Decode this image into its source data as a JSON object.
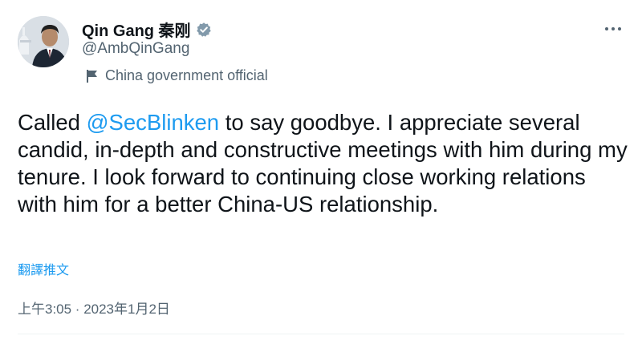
{
  "author": {
    "display_name": "Qin Gang 秦刚",
    "handle": "@AmbQinGang",
    "label": "China government official"
  },
  "tweet": {
    "text_before_mention": "Called ",
    "mention": "@SecBlinken",
    "text_after_mention": " to say goodbye. I appreciate several candid, in-depth and constructive meetings with him during my tenure. I look forward to continuing close working relations with him for a better China-US relationship."
  },
  "translate_label": "翻譯推文",
  "timestamp": "上午3:05 · 2023年1月2日",
  "icons": {
    "verified": "verified-badge-icon",
    "label": "flag-icon",
    "more": "more-options-icon"
  },
  "colors": {
    "link": "#1d9bf0",
    "secondary_text": "#536471",
    "primary_text": "#0f1419",
    "verified_badge": "#829aab"
  }
}
